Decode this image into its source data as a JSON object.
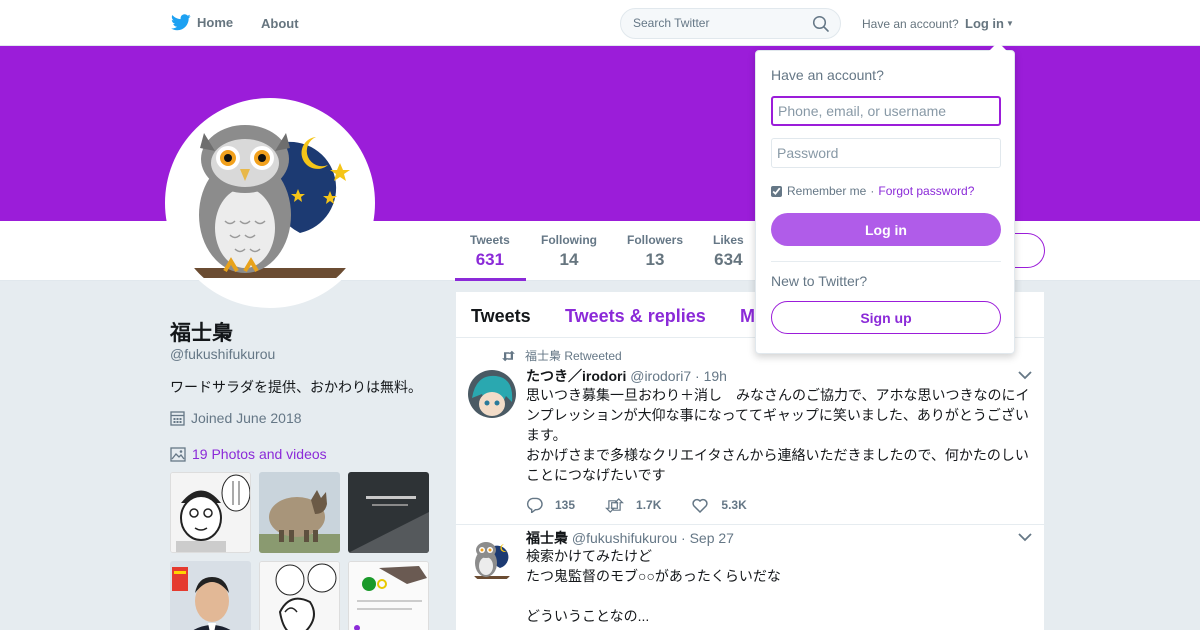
{
  "nav": {
    "home_label": "Home",
    "about_label": "About",
    "search_placeholder": "Search Twitter",
    "have_account": "Have an account?",
    "login_label": "Log in"
  },
  "colors": {
    "banner": "#9b1dd9",
    "accent": "#8b2ad8",
    "login_button": "#b05ce9"
  },
  "profile": {
    "name": "福士梟",
    "handle": "@fukushifukurou",
    "bio": "ワードサラダを提供、おかわりは無料。",
    "joined": "Joined June 2018",
    "photos_label": "19 Photos and videos"
  },
  "stats": [
    {
      "label": "Tweets",
      "value": "631"
    },
    {
      "label": "Following",
      "value": "14"
    },
    {
      "label": "Followers",
      "value": "13"
    },
    {
      "label": "Likes",
      "value": "634"
    }
  ],
  "timeline": {
    "tabs": [
      "Tweets",
      "Tweets & replies",
      "M"
    ],
    "tweets": [
      {
        "retweet_context": "福士梟 Retweeted",
        "fullname": "たつき／irodori",
        "meta": "@irodori7 · 19h",
        "lines": [
          "思いつき募集一旦おわり＋消し　みなさんのご協力で、アホな思いつきなのにイ",
          "ンプレッションが大仰な事になっててギャップに笑いました、ありがとうござい",
          "ます。",
          "おかげさまで多様なクリエイタさんから連絡いただきましたので、何かたのしい",
          "ことにつなげたいです"
        ],
        "replies": "135",
        "retweets": "1.7K",
        "likes": "5.3K"
      },
      {
        "fullname": "福士梟",
        "meta": "@fukushifukurou · Sep 27",
        "lines": [
          "検索かけてみたけど",
          "たつ鬼監督のモブ○○があったくらいだな",
          "",
          "どういうことなの..."
        ]
      }
    ]
  },
  "login_dropdown": {
    "title": "Have an account?",
    "username_placeholder": "Phone, email, or username",
    "password_placeholder": "Password",
    "remember_label": "Remember me",
    "separator": "·",
    "forgot_label": "Forgot password?",
    "login_button": "Log in",
    "new_label": "New to Twitter?",
    "signup_button": "Sign up"
  }
}
